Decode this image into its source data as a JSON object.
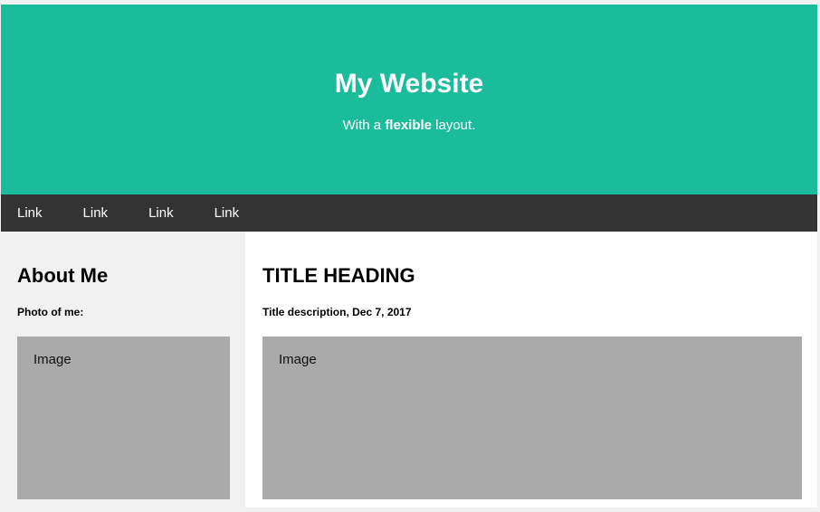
{
  "header": {
    "title": "My Website",
    "subtitle_before": "With a ",
    "subtitle_bold": "flexible",
    "subtitle_after": " layout.",
    "background_color": "#1abc9c"
  },
  "navbar": {
    "links": [
      "Link",
      "Link",
      "Link",
      "Link"
    ],
    "background_color": "#333333"
  },
  "sidebar": {
    "heading": "About Me",
    "caption": "Photo of me:",
    "image_label": "Image"
  },
  "main": {
    "heading": "TITLE HEADING",
    "caption": "Title description, Dec 7, 2017",
    "image_label": "Image"
  }
}
